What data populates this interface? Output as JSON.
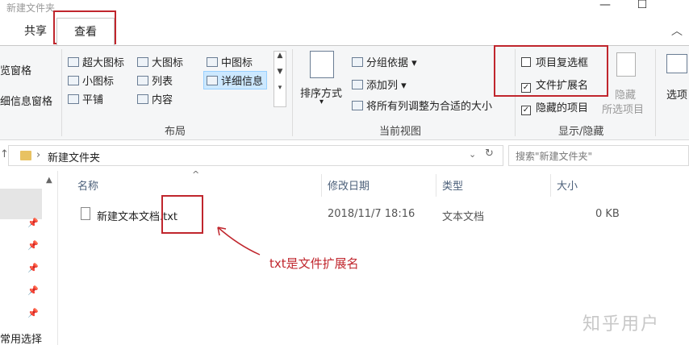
{
  "window": {
    "title": "新建文件夹",
    "minimize": "—",
    "maximize": "☐"
  },
  "tabs": {
    "share": "共享",
    "view": "查看",
    "collapse": "︿"
  },
  "ribbon": {
    "pane_items": [
      "览窗格",
      "细信息窗格"
    ],
    "layout": {
      "items": [
        "超大图标",
        "大图标",
        "中图标",
        "小图标",
        "列表",
        "详细信息",
        "平铺",
        "内容"
      ],
      "group_label": "布局"
    },
    "current_view": {
      "sort": "排序方式",
      "group_by": "分组依据",
      "add_column": "添加列",
      "fit_columns": "将所有列调整为合适的大小",
      "group_label": "当前视图"
    },
    "show_hide": {
      "item_checkboxes": "项目复选框",
      "item_checkboxes_checked": false,
      "file_extensions": "文件扩展名",
      "file_extensions_checked": true,
      "hidden_items": "隐藏的项目",
      "hidden_items_checked": true,
      "hide_selected": "隐藏",
      "hide_selected_sub": "所选项目",
      "group_label": "显示/隐藏"
    },
    "options": "选项"
  },
  "address": {
    "path": "新建文件夹",
    "search_placeholder": "搜索\"新建文件夹\""
  },
  "nav": {
    "quick_access": "常用选择"
  },
  "columns": {
    "name": "名称",
    "modified": "修改日期",
    "type": "类型",
    "size": "大小"
  },
  "files": [
    {
      "name": "新建文本文档.txt",
      "modified": "2018/11/7 18:16",
      "type": "文本文档",
      "size": "0 KB"
    }
  ],
  "annotation": "txt是文件扩展名",
  "watermark": "知乎用户",
  "colors": {
    "highlight": "#c0262d",
    "selection": "#cce8ff"
  }
}
